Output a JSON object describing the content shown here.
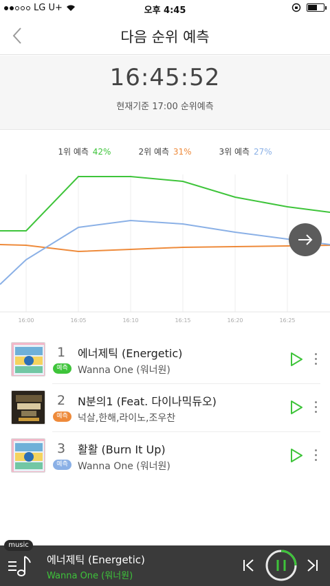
{
  "status": {
    "carrier": "LG U+",
    "time": "오후 4:45"
  },
  "nav": {
    "title": "다음 순위 예측"
  },
  "countdown": {
    "clock": "16:45:52",
    "caption": "현재기준 17:00 순위예측"
  },
  "legend": [
    {
      "label": "1위 예측",
      "pct": "42%",
      "color": "#3ec43a"
    },
    {
      "label": "2위 예측",
      "pct": "31%",
      "color": "#ee8a3a"
    },
    {
      "label": "3위 예측",
      "pct": "27%",
      "color": "#8ab0e6"
    }
  ],
  "chart_data": {
    "type": "line",
    "x": [
      "16:00",
      "16:05",
      "16:10",
      "16:15",
      "16:20",
      "16:25"
    ],
    "series": [
      {
        "name": "1위 예측",
        "color": "#3ec43a"
      },
      {
        "name": "2위 예측",
        "color": "#ee8a3a"
      },
      {
        "name": "3위 예측",
        "color": "#8ab0e6"
      }
    ],
    "grid": true
  },
  "songs": [
    {
      "rank": "1",
      "badge": "예측",
      "badge_color": "#3ec43a",
      "title": "에너제틱 (Energetic)",
      "artist": "Wanna One (워너원)"
    },
    {
      "rank": "2",
      "badge": "예측",
      "badge_color": "#ee8a3a",
      "title": "N분의1 (Feat. 다이나믹듀오)",
      "artist": "넉살,한해,라이노,조우찬"
    },
    {
      "rank": "3",
      "badge": "예측",
      "badge_color": "#8ab0e6",
      "title": "활활 (Burn It Up)",
      "artist": "Wanna One (워너원)"
    }
  ],
  "player": {
    "tag": "music",
    "title": "에너제틱 (Energetic)",
    "artist": "Wanna One (워너원)"
  },
  "icons": {
    "back": "chevron-left-icon",
    "next": "arrow-right-icon",
    "play": "play-icon",
    "more": "more-vertical-icon",
    "library": "music-note-list-icon",
    "prev": "skip-previous-icon",
    "pause": "pause-icon",
    "skip": "skip-next-icon"
  }
}
